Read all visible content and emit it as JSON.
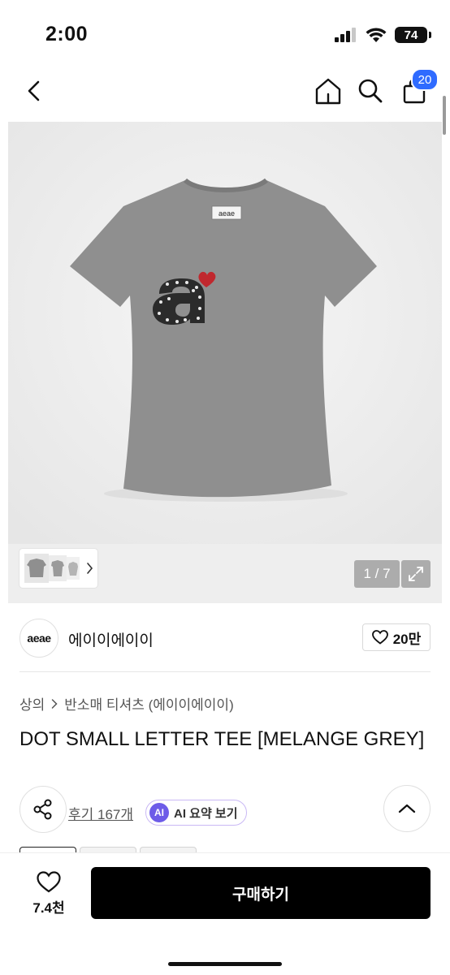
{
  "status_bar": {
    "time": "2:00",
    "battery": "74"
  },
  "header": {
    "cart_count": "20"
  },
  "gallery": {
    "product_image": "grey t-shirt with dotted letter a and red heart",
    "tee_label": "aeae",
    "page_counter": "1 / 7"
  },
  "brand": {
    "logo_text": "aeae",
    "name": "에이이에이이",
    "likes": "20만"
  },
  "breadcrumb": {
    "category": "상의",
    "subcategory": "반소매 티셔츠 (에이이에이이)"
  },
  "product": {
    "title": "DOT SMALL LETTER TEE [MELANGE GREY]"
  },
  "reviews": {
    "label": "후기 167개"
  },
  "ai_summary": {
    "badge": "AI",
    "label": "AI 요약 보기"
  },
  "bottom_bar": {
    "wish_count": "7.4천",
    "buy_label": "구매하기"
  },
  "colors": {
    "accent": "#2f6bff",
    "ai_purple": "#6d5ce8",
    "buy_button": "#000000"
  }
}
